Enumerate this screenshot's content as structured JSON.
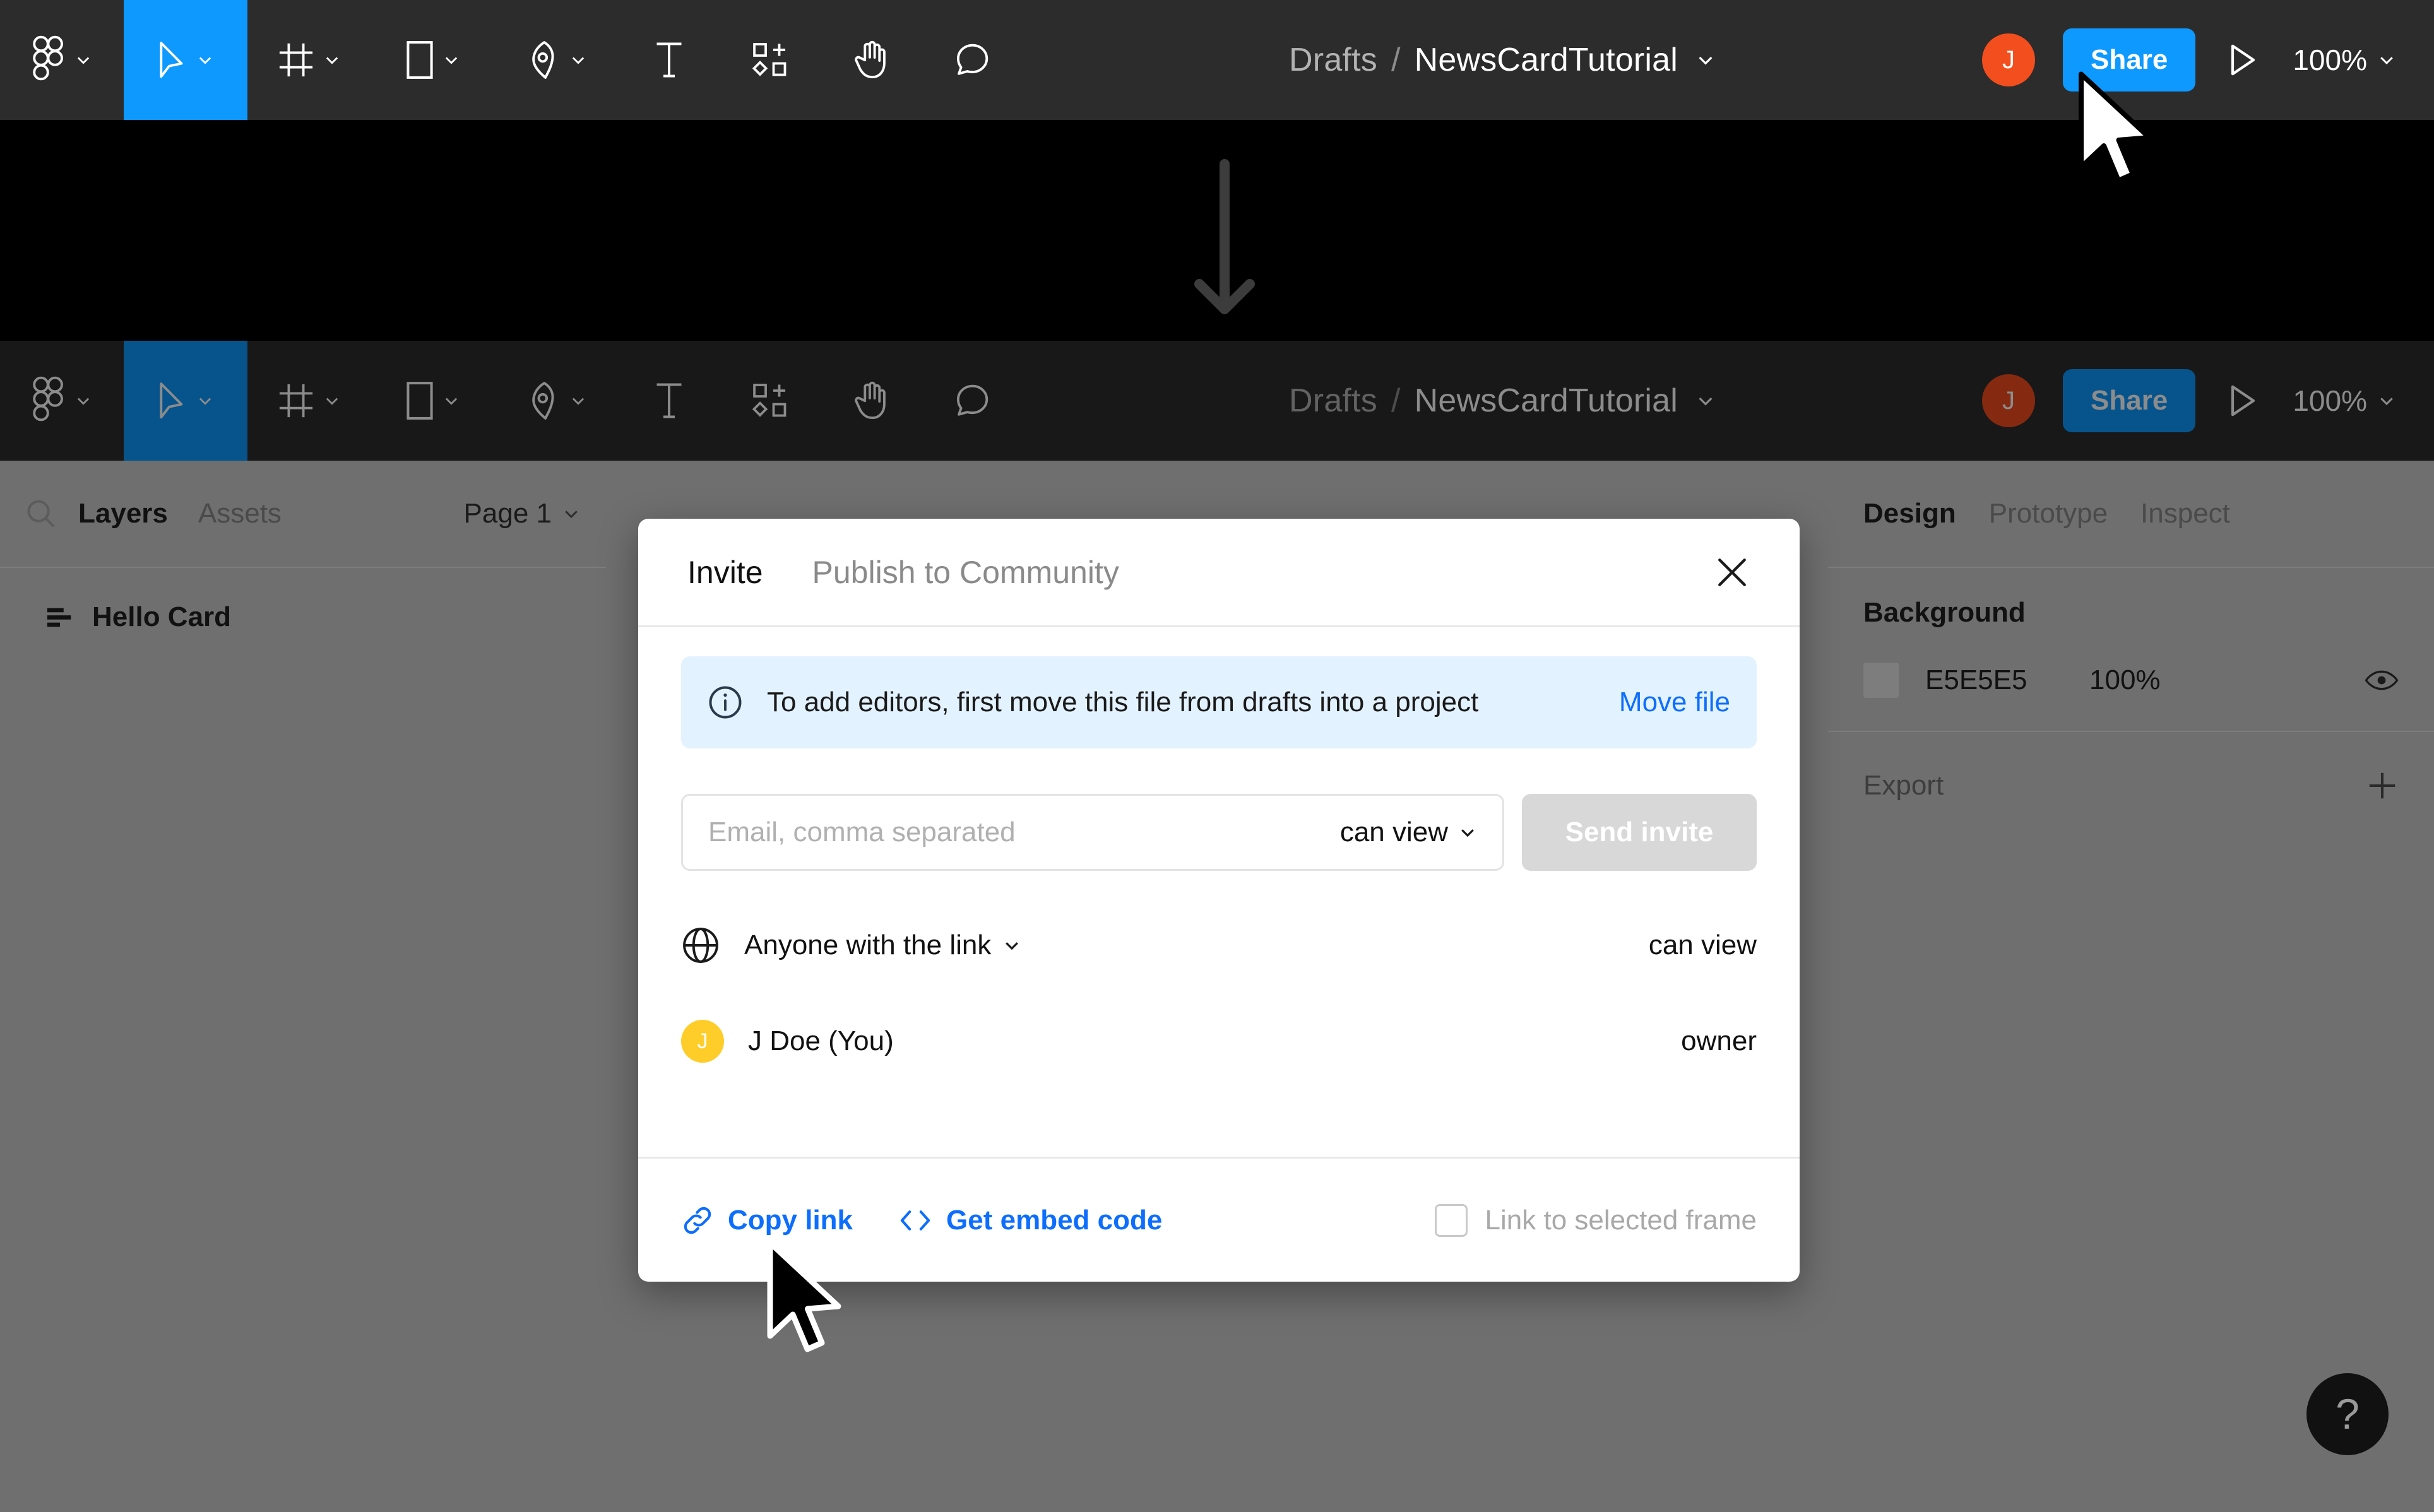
{
  "toolbar": {
    "tools": [
      {
        "name": "figma-menu-icon",
        "label": "Figma menu",
        "caret": true
      },
      {
        "name": "move-tool-icon",
        "label": "Move",
        "caret": true,
        "active": true
      },
      {
        "name": "frame-tool-icon",
        "label": "Frame",
        "caret": true
      },
      {
        "name": "shape-tool-icon",
        "label": "Rectangle",
        "caret": true
      },
      {
        "name": "pen-tool-icon",
        "label": "Pen",
        "caret": true
      },
      {
        "name": "text-tool-icon",
        "label": "Text",
        "caret": false
      },
      {
        "name": "components-tool-icon",
        "label": "Components",
        "caret": false
      },
      {
        "name": "hand-tool-icon",
        "label": "Hand",
        "caret": false
      },
      {
        "name": "comment-tool-icon",
        "label": "Comment",
        "caret": false
      }
    ],
    "breadcrumb": {
      "project": "Drafts",
      "separator": "/",
      "file": "NewsCardTutorial"
    },
    "avatar_initial": "J",
    "avatar_color": "#F24E1E",
    "share_label": "Share",
    "share_color": "#0D99FF",
    "present_icon": "play-icon",
    "zoom_level": "100%"
  },
  "left_panel": {
    "search_icon": "search-icon",
    "tabs": [
      {
        "label": "Layers",
        "active": true
      },
      {
        "label": "Assets",
        "active": false
      }
    ],
    "page_selector": "Page 1",
    "layers": [
      {
        "name": "Hello Card",
        "icon": "text-layer-icon"
      }
    ]
  },
  "right_panel": {
    "tabs": [
      {
        "label": "Design",
        "active": true
      },
      {
        "label": "Prototype",
        "active": false
      },
      {
        "label": "Inspect",
        "active": false
      }
    ],
    "background": {
      "title": "Background",
      "hex": "E5E5E5",
      "swatch_color": "#E5E5E5",
      "opacity": "100%",
      "visibility_icon": "eye-icon"
    },
    "export": {
      "title": "Export",
      "add_icon": "plus-icon"
    }
  },
  "help_button": {
    "glyph": "?",
    "name": "help-icon"
  },
  "modal": {
    "tabs": [
      {
        "label": "Invite",
        "active": true
      },
      {
        "label": "Publish to Community",
        "active": false
      }
    ],
    "close_icon": "close-icon",
    "banner": {
      "icon": "info-icon",
      "text": "To add editors, first move this file from drafts into a project",
      "link_label": "Move file",
      "bg_color": "#E3F2FF",
      "link_color": "#0D6EFD"
    },
    "invite": {
      "email_placeholder": "Email, comma separated",
      "email_value": "",
      "permission": "can view",
      "send_label": "Send invite",
      "send_disabled": true
    },
    "share_rows": [
      {
        "icon": "globe-icon",
        "label": "Anyone with the link",
        "has_caret": true,
        "permission": "can view",
        "avatar": null
      },
      {
        "icon": "avatar",
        "label": "J Doe (You)",
        "has_caret": false,
        "permission": "owner",
        "avatar": {
          "initial": "J",
          "color": "#FFCD29"
        }
      }
    ],
    "footer": {
      "copy_link_label": "Copy link",
      "copy_link_icon": "link-icon",
      "embed_label": "Get embed code",
      "embed_icon": "code-icon",
      "checkbox_label": "Link to selected frame",
      "checkbox_checked": false
    }
  },
  "annotation": {
    "arrow_icon": "down-arrow-icon",
    "arrow_color": "#3C3C3C"
  },
  "cursors": [
    {
      "name": "cursor-share",
      "style": "white"
    },
    {
      "name": "cursor-copy",
      "style": "black"
    }
  ]
}
